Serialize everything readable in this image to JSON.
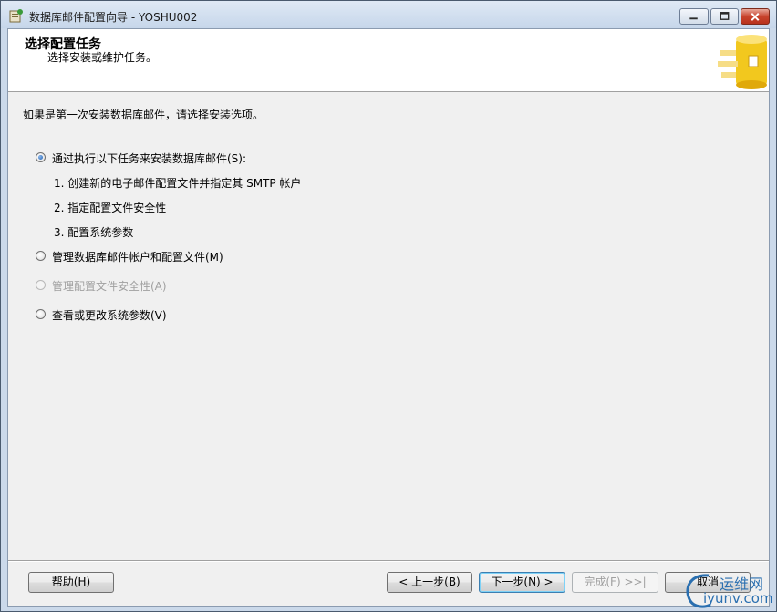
{
  "window": {
    "title": "数据库邮件配置向导 - YOSHU002",
    "icon": "wizard-app-icon"
  },
  "header": {
    "title": "选择配置任务",
    "subtitle": "选择安装或维护任务。",
    "image": "database-gold-icon"
  },
  "intro": "如果是第一次安装数据库邮件，请选择安装选项。",
  "options": [
    {
      "label": "通过执行以下任务来安装数据库邮件(S):",
      "checked": true,
      "enabled": true
    },
    {
      "label": "管理数据库邮件帐户和配置文件(M)",
      "checked": false,
      "enabled": true
    },
    {
      "label": "管理配置文件安全性(A)",
      "checked": false,
      "enabled": false
    },
    {
      "label": "查看或更改系统参数(V)",
      "checked": false,
      "enabled": true
    }
  ],
  "steps": [
    "1.  创建新的电子邮件配置文件并指定其 SMTP 帐户",
    "2.  指定配置文件安全性",
    "3.  配置系统参数"
  ],
  "buttons": {
    "help": "帮助(H)",
    "back": "< 上一步(B)",
    "next": "下一步(N) >",
    "finish": "完成(F) >>|",
    "cancel": "取消"
  },
  "watermark": {
    "line1": "运维网",
    "line2": "iyunv.com"
  },
  "colors": {
    "accent": "#1a5fb4",
    "close_button": "#c8432d"
  }
}
